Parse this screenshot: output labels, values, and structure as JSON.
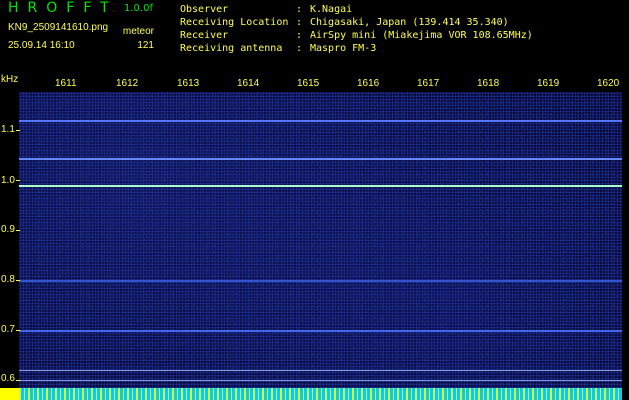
{
  "app": {
    "title": "HROFFT",
    "version": "1.0.0f"
  },
  "file": {
    "name": "KN9_2509141610.png",
    "mode": "meteor",
    "timestamp": "25.09.14 16:10",
    "count": "121"
  },
  "info": [
    {
      "key": "Observer",
      "sep": ":",
      "value": "K.Nagai"
    },
    {
      "key": "Receiving Location",
      "sep": ":",
      "value": "Chigasaki, Japan (139.414 35.340)"
    },
    {
      "key": "Receiver",
      "sep": ":",
      "value": "AirSpy mini (Miakejima VOR 108.65MHz)"
    },
    {
      "key": "Receiving antenna",
      "sep": ":",
      "value": "Maspro FM-3"
    }
  ],
  "axis": {
    "unit": "kHz",
    "x_ticks": [
      "1611",
      "1612",
      "1613",
      "1614",
      "1615",
      "1616",
      "1617",
      "1618",
      "1619",
      "1620"
    ],
    "y_ticks": [
      "1.1",
      "1.0",
      "0.9",
      "0.8",
      "0.7",
      "0.6"
    ]
  },
  "colors": {
    "label": "#ffff55",
    "title": "#00e600",
    "bg": "#06082a",
    "accent": "#00ccff"
  },
  "chart_data": {
    "type": "heatmap",
    "xlabel": "",
    "ylabel": "kHz",
    "x_ticks": [
      "1611",
      "1612",
      "1613",
      "1614",
      "1615",
      "1616",
      "1617",
      "1618",
      "1619",
      "1620"
    ],
    "y_ticks": [
      1.1,
      1.0,
      0.9,
      0.8,
      0.7,
      0.6
    ],
    "horizontal_lines_khz": [
      1.12,
      1.045,
      0.99,
      0.8,
      0.7,
      0.62,
      0.6
    ]
  }
}
